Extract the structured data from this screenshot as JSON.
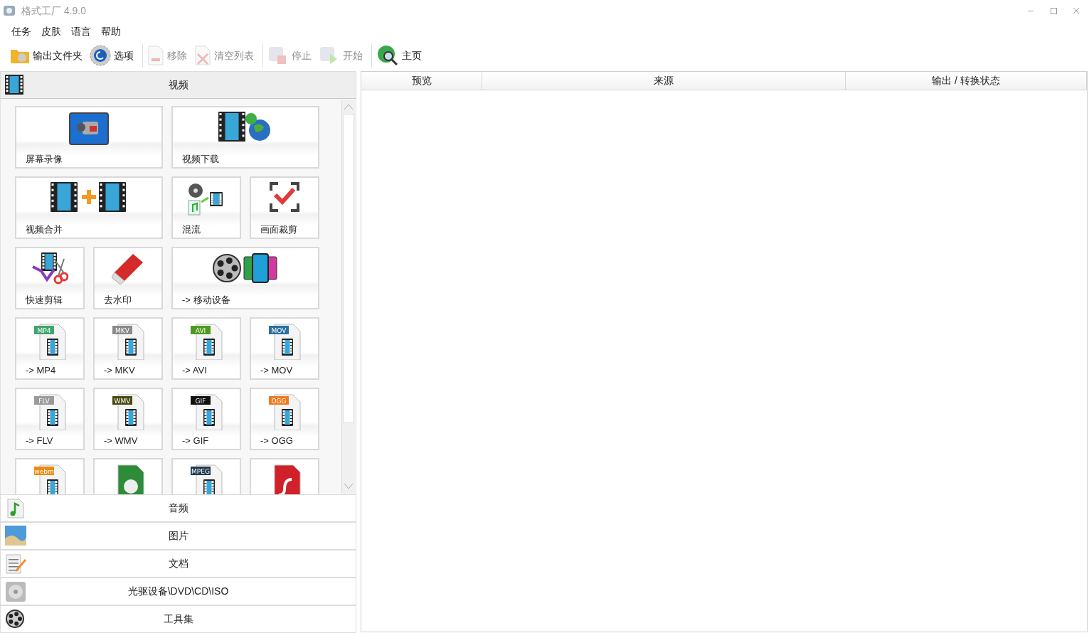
{
  "window": {
    "title": "格式工厂 4.9.0"
  },
  "menu": [
    "任务",
    "皮肤",
    "语言",
    "帮助"
  ],
  "toolbar": {
    "groups": [
      [
        {
          "label": "输出文件夹",
          "disabled": false
        },
        {
          "label": "选项",
          "disabled": false
        }
      ],
      [
        {
          "label": "移除",
          "disabled": true
        },
        {
          "label": "清空列表",
          "disabled": true
        }
      ],
      [
        {
          "label": "停止",
          "disabled": true
        },
        {
          "label": "开始",
          "disabled": true
        }
      ],
      [
        {
          "label": "主页",
          "disabled": false
        }
      ]
    ]
  },
  "categories": [
    {
      "label": "视频",
      "expanded": true
    },
    {
      "label": "音频",
      "expanded": false
    },
    {
      "label": "图片",
      "expanded": false
    },
    {
      "label": "文档",
      "expanded": false
    },
    {
      "label": "光驱设备\\DVD\\CD\\ISO",
      "expanded": false
    },
    {
      "label": "工具集",
      "expanded": false
    }
  ],
  "tiles": [
    {
      "kind": "feature",
      "label": "屏幕录像",
      "wide": true
    },
    {
      "kind": "feature",
      "label": "视频下载",
      "wide": true
    },
    {
      "kind": "feature",
      "label": "视频合并",
      "wide": true
    },
    {
      "kind": "feature",
      "label": "混流",
      "wide": false
    },
    {
      "kind": "feature",
      "label": "画面裁剪",
      "wide": false
    },
    {
      "kind": "feature",
      "label": "快速剪辑",
      "wide": false
    },
    {
      "kind": "feature",
      "label": "去水印",
      "wide": false
    },
    {
      "kind": "feature",
      "label": "-> 移动设备",
      "wide": true
    },
    {
      "kind": "format",
      "label": "-> MP4",
      "badge": "MP4",
      "color": "#3fa66b"
    },
    {
      "kind": "format",
      "label": "-> MKV",
      "badge": "MKV",
      "color": "#8a8a8a"
    },
    {
      "kind": "format",
      "label": "-> AVI",
      "badge": "AVI",
      "color": "#4e9a1e"
    },
    {
      "kind": "format",
      "label": "-> MOV",
      "badge": "MOV",
      "color": "#2d6f9e"
    },
    {
      "kind": "format",
      "label": "-> FLV",
      "badge": "FLV",
      "color": "#9a9a9a"
    },
    {
      "kind": "format",
      "label": "-> WMV",
      "badge": "WMV",
      "color": "#4a4a12"
    },
    {
      "kind": "format",
      "label": "-> GIF",
      "badge": "GIF",
      "color": "#111111"
    },
    {
      "kind": "format",
      "label": "-> OGG",
      "badge": "OGG",
      "color": "#f07a1a"
    },
    {
      "kind": "format",
      "badge": "webm",
      "color": "#f08a10"
    },
    {
      "kind": "format"
    },
    {
      "kind": "format",
      "badge": "MPEG",
      "color": "#1f3a4f"
    },
    {
      "kind": "format"
    }
  ],
  "table": {
    "columns": [
      "预览",
      "来源",
      "输出 / 转换状态"
    ]
  }
}
